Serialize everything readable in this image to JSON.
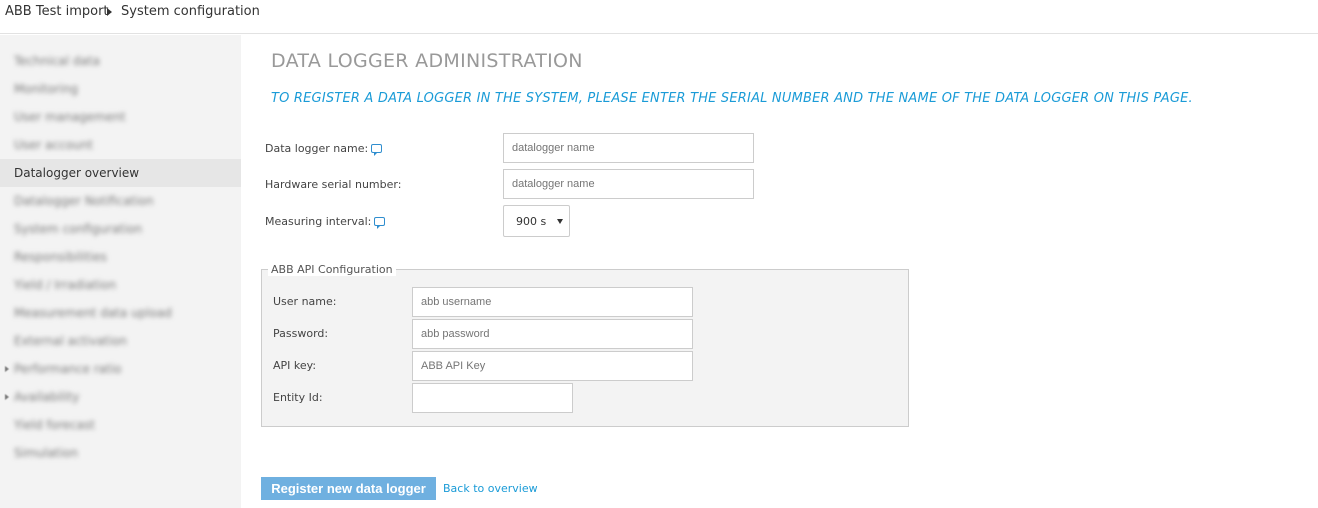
{
  "breadcrumb": {
    "items": [
      "ABB Test import",
      "System configuration"
    ]
  },
  "sidebar": {
    "items": [
      {
        "label": "Technical data",
        "active": false
      },
      {
        "label": "Monitoring",
        "active": false
      },
      {
        "label": "User management",
        "active": false
      },
      {
        "label": "User account",
        "active": false
      },
      {
        "label": "Datalogger overview",
        "active": true
      },
      {
        "label": "Datalogger Notification",
        "active": false
      },
      {
        "label": "System configuration",
        "active": false
      },
      {
        "label": "Responsibilities",
        "active": false
      },
      {
        "label": "Yield / Irradiation",
        "active": false
      },
      {
        "label": "Measurement data upload",
        "active": false
      },
      {
        "label": "External activation",
        "active": false
      },
      {
        "label": "Performance ratio",
        "active": false
      },
      {
        "label": "Availability",
        "active": false
      },
      {
        "label": "Yield forecast",
        "active": false
      },
      {
        "label": "Simulation",
        "active": false
      }
    ]
  },
  "main": {
    "title": "DATA LOGGER ADMINISTRATION",
    "instruction": "TO REGISTER A DATA LOGGER IN THE SYSTEM, PLEASE ENTER THE SERIAL NUMBER AND THE NAME OF THE DATA LOGGER ON THIS PAGE.",
    "form": {
      "name_label": "Data logger name:",
      "name_placeholder": "datalogger name",
      "serial_label": "Hardware serial number:",
      "serial_placeholder": "datalogger name",
      "interval_label": "Measuring interval:",
      "interval_value": "900 s"
    },
    "api": {
      "legend": "ABB API Configuration",
      "username_label": "User name:",
      "username_placeholder": "abb username",
      "password_label": "Password:",
      "password_placeholder": "abb password",
      "apikey_label": "API key:",
      "apikey_placeholder": "ABB API Key",
      "entity_label": "Entity Id:",
      "entity_placeholder": ""
    },
    "actions": {
      "submit_label": "Register new data logger",
      "back_label": "Back to overview"
    }
  },
  "icons": {
    "help": "speech-bubble-icon",
    "breadcrumb_separator": "caret-right-icon",
    "dropdown": "caret-down-icon"
  },
  "colors": {
    "accent": "#1a9bd7",
    "button": "#6fb0e0",
    "sidebar_bg": "#f3f3f3",
    "sidebar_active": "#e6e6e6",
    "title": "#999999"
  }
}
